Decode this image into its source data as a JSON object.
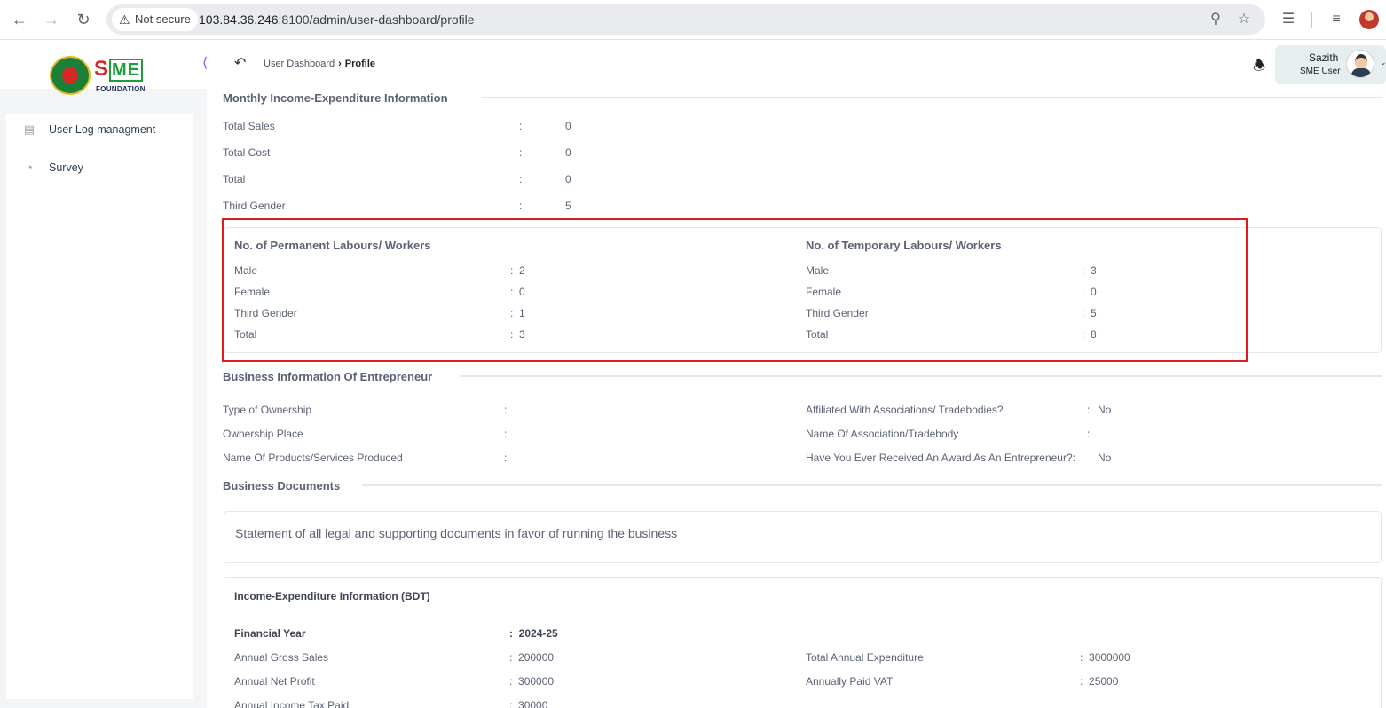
{
  "browser": {
    "not_secure": "Not secure",
    "url_host": "103.84.36.246",
    "url_rest": ":8100/admin/user-dashboard/profile"
  },
  "header": {
    "logo_main": "S",
    "logo_me": "ME",
    "logo_sub": "FOUNDATION",
    "breadcrumb_parent": "User Dashboard",
    "breadcrumb_current": "Profile",
    "user_name": "Sazith",
    "user_role": "SME User"
  },
  "sidebar": {
    "items": [
      {
        "label": "User Log managment",
        "icon": "log-icon"
      },
      {
        "label": "Survey",
        "icon": "pie-chart-icon"
      }
    ]
  },
  "monthly": {
    "title": "Monthly Income-Expenditure Information",
    "rows": [
      {
        "label": "Total Sales",
        "value": "0"
      },
      {
        "label": "Total Cost",
        "value": "0"
      },
      {
        "label": "Total",
        "value": "0"
      },
      {
        "label": "Third Gender",
        "value": "5"
      }
    ]
  },
  "labour": {
    "permanent_title": "No. of Permanent Labours/ Workers",
    "temporary_title": "No. of Temporary Labours/ Workers",
    "permanent": [
      {
        "label": "Male",
        "value": "2"
      },
      {
        "label": "Female",
        "value": "0"
      },
      {
        "label": "Third Gender",
        "value": "1"
      },
      {
        "label": "Total",
        "value": "3"
      }
    ],
    "temporary": [
      {
        "label": "Male",
        "value": "3"
      },
      {
        "label": "Female",
        "value": "0"
      },
      {
        "label": "Third Gender",
        "value": "5"
      },
      {
        "label": "Total",
        "value": "8"
      }
    ]
  },
  "business": {
    "title": "Business Information Of Entrepreneur",
    "left": [
      {
        "label": "Type of Ownership",
        "value": ""
      },
      {
        "label": "Ownership Place",
        "value": ""
      },
      {
        "label": "Name Of Products/Services Produced",
        "value": ""
      }
    ],
    "right": [
      {
        "label": "Affiliated With Associations/ Tradebodies?",
        "value": "No"
      },
      {
        "label": "Name Of Association/Tradebody",
        "value": ""
      },
      {
        "label": "Have You Ever Received An Award As An Entrepreneur?:",
        "value": "No"
      }
    ]
  },
  "documents": {
    "title": "Business Documents",
    "statement": "Statement of all legal and supporting documents in favor of running the business"
  },
  "income": {
    "title": "Income-Expenditure Information (BDT)",
    "financial_year_label": "Financial Year",
    "financial_year_value": "2024-25",
    "left": [
      {
        "label": "Annual Gross Sales",
        "value": "200000"
      },
      {
        "label": "Annual Net Profit",
        "value": "300000"
      },
      {
        "label": "Annual Income Tax Paid",
        "value": "30000"
      }
    ],
    "right": [
      {
        "label": "Total Annual Expenditure",
        "value": "3000000"
      },
      {
        "label": "Annually Paid VAT",
        "value": "25000"
      }
    ]
  },
  "colors": {
    "highlight": "#e01b1b",
    "logo_red": "#d62828",
    "logo_green": "#1f9d3a"
  }
}
